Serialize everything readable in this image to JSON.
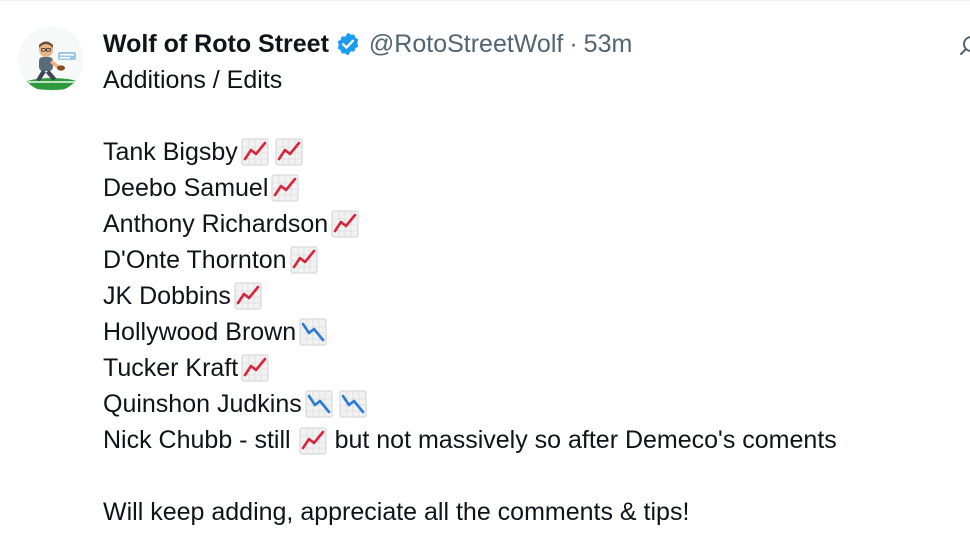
{
  "tweet": {
    "author": {
      "display_name": "Wolf of Roto Street",
      "handle": "@RotoStreetWolf",
      "verified": true,
      "avatar_icon": "cartoon-running-football-player-avatar"
    },
    "separator": "·",
    "time": "53m",
    "more_icon": "search-icon",
    "heading": "Additions / Edits",
    "entries": [
      {
        "name": "Tank Bigsby",
        "trend": [
          "up",
          "up"
        ]
      },
      {
        "name": "Deebo Samuel",
        "trend": [
          "up"
        ]
      },
      {
        "name": "Anthony Richardson",
        "trend": [
          "up"
        ]
      },
      {
        "name": "D'Onte Thornton",
        "trend": [
          "up"
        ]
      },
      {
        "name": "JK Dobbins",
        "trend": [
          "up"
        ]
      },
      {
        "name": "Hollywood Brown",
        "trend": [
          "down"
        ]
      },
      {
        "name": "Tucker Kraft",
        "trend": [
          "up"
        ]
      },
      {
        "name": "Quinshon Judkins",
        "trend": [
          "down",
          "down"
        ]
      }
    ],
    "chubb": {
      "prefix": "Nick Chubb - still",
      "trend": "up",
      "suffix": "but not massively so after Demeco's coments"
    },
    "closing": "Will keep adding, appreciate all the comments & tips!"
  },
  "colors": {
    "text": "#0f1419",
    "secondary": "#536471",
    "verified": "#1d9bf0",
    "trend_up": "#d7263d",
    "trend_down": "#2b7bd6"
  }
}
